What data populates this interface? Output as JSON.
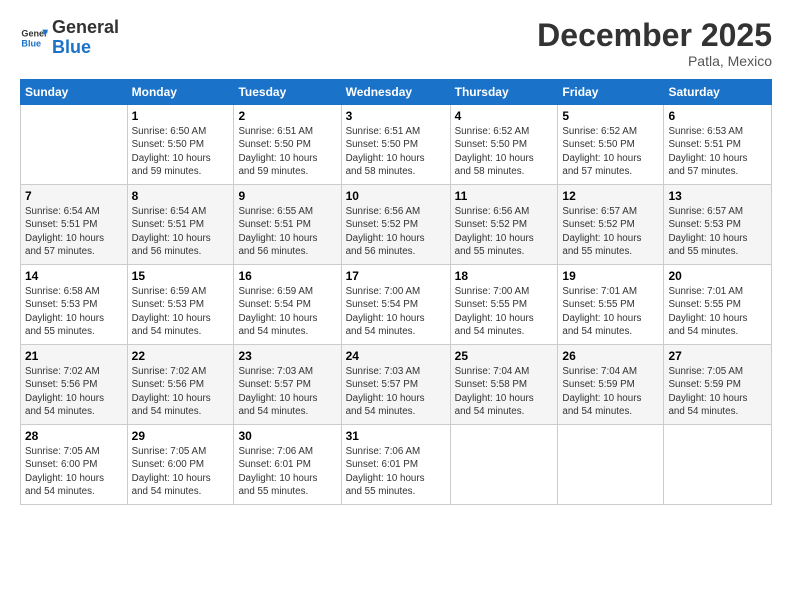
{
  "header": {
    "logo_text_general": "General",
    "logo_text_blue": "Blue",
    "month_title": "December 2025",
    "subtitle": "Patla, Mexico"
  },
  "weekdays": [
    "Sunday",
    "Monday",
    "Tuesday",
    "Wednesday",
    "Thursday",
    "Friday",
    "Saturday"
  ],
  "rows": [
    [
      {
        "day": "",
        "info": ""
      },
      {
        "day": "1",
        "info": "Sunrise: 6:50 AM\nSunset: 5:50 PM\nDaylight: 10 hours\nand 59 minutes."
      },
      {
        "day": "2",
        "info": "Sunrise: 6:51 AM\nSunset: 5:50 PM\nDaylight: 10 hours\nand 59 minutes."
      },
      {
        "day": "3",
        "info": "Sunrise: 6:51 AM\nSunset: 5:50 PM\nDaylight: 10 hours\nand 58 minutes."
      },
      {
        "day": "4",
        "info": "Sunrise: 6:52 AM\nSunset: 5:50 PM\nDaylight: 10 hours\nand 58 minutes."
      },
      {
        "day": "5",
        "info": "Sunrise: 6:52 AM\nSunset: 5:50 PM\nDaylight: 10 hours\nand 57 minutes."
      },
      {
        "day": "6",
        "info": "Sunrise: 6:53 AM\nSunset: 5:51 PM\nDaylight: 10 hours\nand 57 minutes."
      }
    ],
    [
      {
        "day": "7",
        "info": "Sunrise: 6:54 AM\nSunset: 5:51 PM\nDaylight: 10 hours\nand 57 minutes."
      },
      {
        "day": "8",
        "info": "Sunrise: 6:54 AM\nSunset: 5:51 PM\nDaylight: 10 hours\nand 56 minutes."
      },
      {
        "day": "9",
        "info": "Sunrise: 6:55 AM\nSunset: 5:51 PM\nDaylight: 10 hours\nand 56 minutes."
      },
      {
        "day": "10",
        "info": "Sunrise: 6:56 AM\nSunset: 5:52 PM\nDaylight: 10 hours\nand 56 minutes."
      },
      {
        "day": "11",
        "info": "Sunrise: 6:56 AM\nSunset: 5:52 PM\nDaylight: 10 hours\nand 55 minutes."
      },
      {
        "day": "12",
        "info": "Sunrise: 6:57 AM\nSunset: 5:52 PM\nDaylight: 10 hours\nand 55 minutes."
      },
      {
        "day": "13",
        "info": "Sunrise: 6:57 AM\nSunset: 5:53 PM\nDaylight: 10 hours\nand 55 minutes."
      }
    ],
    [
      {
        "day": "14",
        "info": "Sunrise: 6:58 AM\nSunset: 5:53 PM\nDaylight: 10 hours\nand 55 minutes."
      },
      {
        "day": "15",
        "info": "Sunrise: 6:59 AM\nSunset: 5:53 PM\nDaylight: 10 hours\nand 54 minutes."
      },
      {
        "day": "16",
        "info": "Sunrise: 6:59 AM\nSunset: 5:54 PM\nDaylight: 10 hours\nand 54 minutes."
      },
      {
        "day": "17",
        "info": "Sunrise: 7:00 AM\nSunset: 5:54 PM\nDaylight: 10 hours\nand 54 minutes."
      },
      {
        "day": "18",
        "info": "Sunrise: 7:00 AM\nSunset: 5:55 PM\nDaylight: 10 hours\nand 54 minutes."
      },
      {
        "day": "19",
        "info": "Sunrise: 7:01 AM\nSunset: 5:55 PM\nDaylight: 10 hours\nand 54 minutes."
      },
      {
        "day": "20",
        "info": "Sunrise: 7:01 AM\nSunset: 5:55 PM\nDaylight: 10 hours\nand 54 minutes."
      }
    ],
    [
      {
        "day": "21",
        "info": "Sunrise: 7:02 AM\nSunset: 5:56 PM\nDaylight: 10 hours\nand 54 minutes."
      },
      {
        "day": "22",
        "info": "Sunrise: 7:02 AM\nSunset: 5:56 PM\nDaylight: 10 hours\nand 54 minutes."
      },
      {
        "day": "23",
        "info": "Sunrise: 7:03 AM\nSunset: 5:57 PM\nDaylight: 10 hours\nand 54 minutes."
      },
      {
        "day": "24",
        "info": "Sunrise: 7:03 AM\nSunset: 5:57 PM\nDaylight: 10 hours\nand 54 minutes."
      },
      {
        "day": "25",
        "info": "Sunrise: 7:04 AM\nSunset: 5:58 PM\nDaylight: 10 hours\nand 54 minutes."
      },
      {
        "day": "26",
        "info": "Sunrise: 7:04 AM\nSunset: 5:59 PM\nDaylight: 10 hours\nand 54 minutes."
      },
      {
        "day": "27",
        "info": "Sunrise: 7:05 AM\nSunset: 5:59 PM\nDaylight: 10 hours\nand 54 minutes."
      }
    ],
    [
      {
        "day": "28",
        "info": "Sunrise: 7:05 AM\nSunset: 6:00 PM\nDaylight: 10 hours\nand 54 minutes."
      },
      {
        "day": "29",
        "info": "Sunrise: 7:05 AM\nSunset: 6:00 PM\nDaylight: 10 hours\nand 54 minutes."
      },
      {
        "day": "30",
        "info": "Sunrise: 7:06 AM\nSunset: 6:01 PM\nDaylight: 10 hours\nand 55 minutes."
      },
      {
        "day": "31",
        "info": "Sunrise: 7:06 AM\nSunset: 6:01 PM\nDaylight: 10 hours\nand 55 minutes."
      },
      {
        "day": "",
        "info": ""
      },
      {
        "day": "",
        "info": ""
      },
      {
        "day": "",
        "info": ""
      }
    ]
  ]
}
